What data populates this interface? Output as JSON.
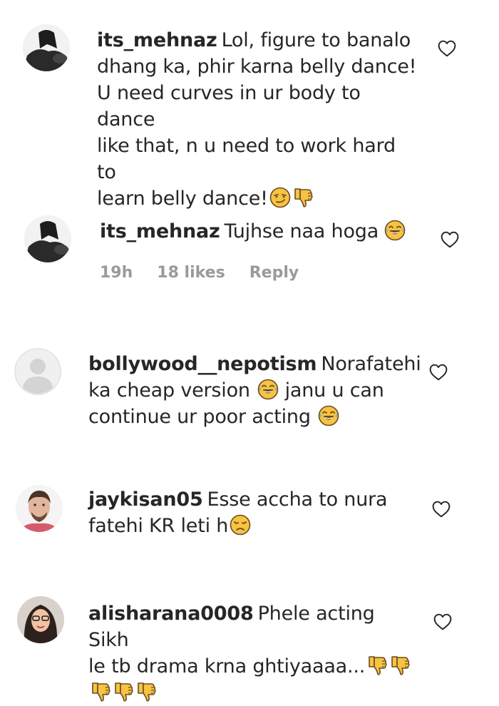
{
  "comments": [
    {
      "username": "its_mehnaz",
      "text": "Lol, figure to banalo dhang ka, phir karna belly dance! U need curves in ur body to dance like that, n u need to work hard to learn belly dance!",
      "line1_text": "Lol, figure to banalo",
      "line2": "dhang ka, phir karna belly dance!",
      "line3": "U need curves in ur body to dance",
      "line4": "like that, n u need to work hard to",
      "line5": "learn belly dance!",
      "emojis": [
        "smirk-face-icon",
        "thumbs-down-icon"
      ]
    },
    {
      "username": "its_mehnaz",
      "text": "Tujhse naa hoga",
      "emojis": [
        "laughing-tears-face-icon"
      ],
      "time": "19h",
      "likes": "18 likes",
      "reply_label": "Reply"
    },
    {
      "username": "bollywood__nepotism",
      "text": "Norafatehi ka cheap version janu u can continue ur poor acting",
      "line1_text": "Norafatehi",
      "line2a": "ka cheap version",
      "line2b": "janu u can",
      "line3": "continue ur poor acting",
      "emojis": [
        "laughing-tears-face-icon",
        "laughing-tears-face-icon"
      ]
    },
    {
      "username": "jaykisan05",
      "text": "Esse accha to nura fatehi KR leti h",
      "line1_text": "Esse accha to nura",
      "line2": "fatehi KR leti h",
      "emojis": [
        "disappointed-face-icon"
      ]
    },
    {
      "username": "alisharana0008",
      "text": "Phele acting Sikh le tb drama krna ghtiyaaaa...",
      "line1_text": "Phele acting Sikh",
      "line2": "le tb drama krna ghtiyaaaa...",
      "emojis": [
        "thumbs-down-icon",
        "thumbs-down-icon",
        "thumbs-down-icon",
        "thumbs-down-icon",
        "thumbs-down-icon"
      ]
    }
  ],
  "colors": {
    "text": "#262626",
    "meta": "#9a9a9a",
    "emoji_yellow": "#f6c343",
    "emoji_dark": "#6b4b1f"
  }
}
